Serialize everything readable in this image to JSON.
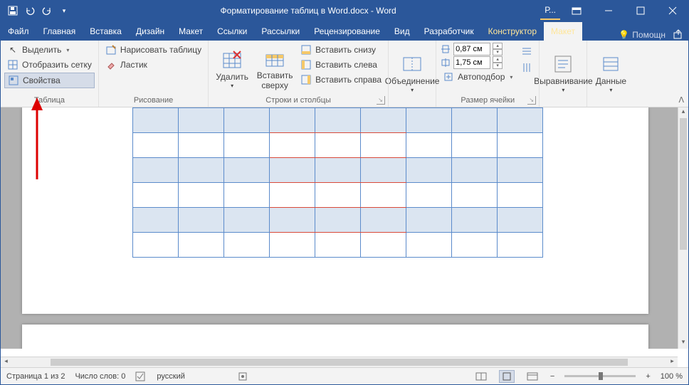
{
  "title": "Форматирование таблиц в Word.docx - Word",
  "quickAccess": {
    "p_indicator": "Р..."
  },
  "tabs": {
    "file": "Файл",
    "home": "Главная",
    "insert": "Вставка",
    "design": "Дизайн",
    "layout": "Макет",
    "references": "Ссылки",
    "mailings": "Рассылки",
    "review": "Рецензирование",
    "view": "Вид",
    "developer": "Разработчик",
    "constructor": "Конструктор",
    "layout2": "Макет",
    "help": "Помощн"
  },
  "ribbon": {
    "table": {
      "select": "Выделить",
      "showGrid": "Отобразить сетку",
      "properties": "Свойства",
      "label": "Таблица"
    },
    "drawing": {
      "drawTable": "Нарисовать таблицу",
      "eraser": "Ластик",
      "label": "Рисование"
    },
    "rowscols": {
      "delete": "Удалить",
      "insertAbove": "Вставить сверху",
      "insertBelow": "Вставить снизу",
      "insertLeft": "Вставить слева",
      "insertRight": "Вставить справа",
      "label": "Строки и столбцы"
    },
    "merge": {
      "merge": "Объединение",
      "label": ""
    },
    "cellsize": {
      "height": "0,87 см",
      "width": "1,75 см",
      "autofit": "Автоподбор",
      "label": "Размер ячейки"
    },
    "alignment": {
      "alignment": "Выравнивание",
      "label": ""
    },
    "data": {
      "data": "Данные",
      "label": ""
    }
  },
  "status": {
    "page": "Страница 1 из 2",
    "words": "Число слов: 0",
    "lang": "русский",
    "zoom": "100 %"
  }
}
